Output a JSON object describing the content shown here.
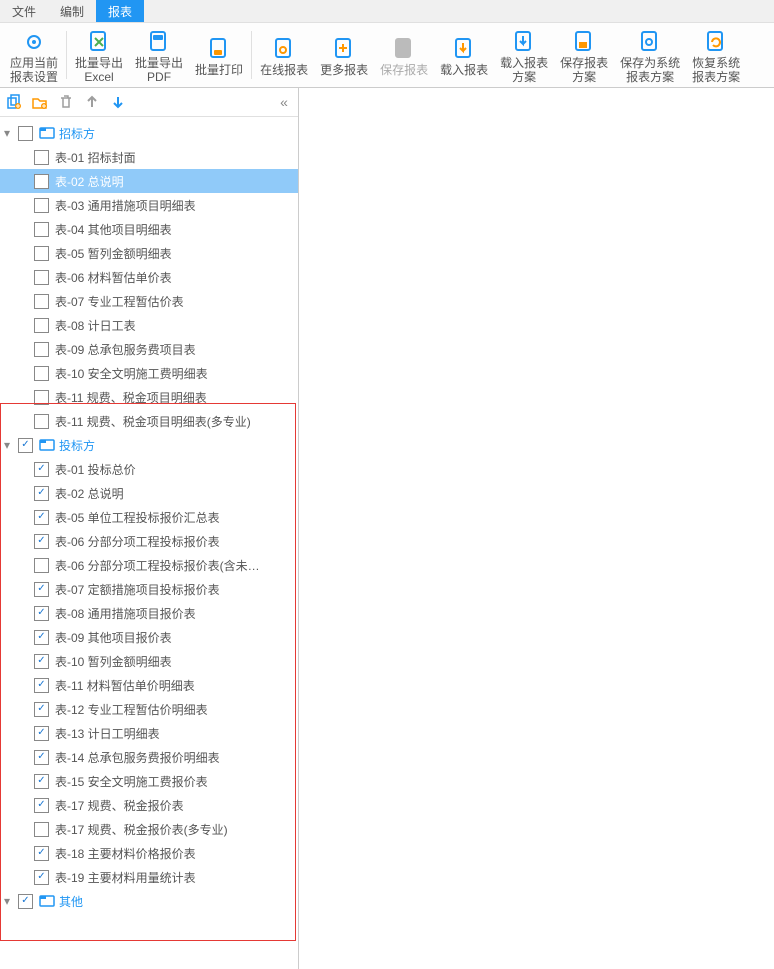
{
  "menu": {
    "items": [
      "文件",
      "编制",
      "报表"
    ],
    "active_index": 2
  },
  "ribbon": [
    {
      "id": "apply-current",
      "icon": "gear",
      "label": "应用当前\n报表设置",
      "disabled": false
    },
    {
      "sep": true
    },
    {
      "id": "batch-export-excel",
      "icon": "page-x",
      "label": "批量导出\nExcel",
      "disabled": false
    },
    {
      "id": "batch-export-pdf",
      "icon": "page-pdf",
      "label": "批量导出\nPDF",
      "disabled": false
    },
    {
      "id": "batch-print",
      "icon": "page-print",
      "label": "批量打印",
      "disabled": false
    },
    {
      "sep": true
    },
    {
      "id": "online-report",
      "icon": "page-cloud",
      "label": "在线报表",
      "disabled": false
    },
    {
      "id": "more-reports",
      "icon": "page-more",
      "label": "更多报表",
      "disabled": false
    },
    {
      "id": "save-report",
      "icon": "page-save",
      "label": "保存报表",
      "disabled": true
    },
    {
      "id": "import-report",
      "icon": "page-import",
      "label": "载入报表",
      "disabled": false
    },
    {
      "id": "import-report-scheme",
      "icon": "page-import2",
      "label": "载入报表\n方案",
      "disabled": false
    },
    {
      "id": "save-report-scheme",
      "icon": "page-save2",
      "label": "保存报表\n方案",
      "disabled": false
    },
    {
      "id": "save-as-system",
      "icon": "page-sys",
      "label": "保存为系统\n报表方案",
      "disabled": false
    },
    {
      "id": "restore-system",
      "icon": "page-restore",
      "label": "恢复系统\n报表方案",
      "disabled": false
    }
  ],
  "side_tb": {
    "icons": [
      {
        "id": "copy-add",
        "name": "copy-add-icon"
      },
      {
        "id": "folder-add",
        "name": "folder-add-icon"
      },
      {
        "id": "delete",
        "name": "trash-icon"
      },
      {
        "id": "move-up",
        "name": "arrow-up-icon"
      },
      {
        "id": "move-down",
        "name": "arrow-down-icon"
      }
    ],
    "collapse": "«"
  },
  "tree": [
    {
      "kind": "group",
      "label": "招标方",
      "checked": false,
      "blue": true,
      "children": [
        {
          "label": "表-01 招标封面",
          "checked": false
        },
        {
          "label": "表-02 总说明",
          "checked": false,
          "selected": true
        },
        {
          "label": "表-03 通用措施项目明细表",
          "checked": false
        },
        {
          "label": "表-04 其他项目明细表",
          "checked": false
        },
        {
          "label": "表-05 暂列金额明细表",
          "checked": false
        },
        {
          "label": "表-06 材料暂估单价表",
          "checked": false
        },
        {
          "label": "表-07 专业工程暂估价表",
          "checked": false
        },
        {
          "label": "表-08 计日工表",
          "checked": false
        },
        {
          "label": "表-09 总承包服务费项目表",
          "checked": false
        },
        {
          "label": "表-10 安全文明施工费明细表",
          "checked": false
        },
        {
          "label": "表-11 规费、税金项目明细表",
          "checked": false
        },
        {
          "label": "表-11 规费、税金项目明细表(多专业)",
          "checked": false
        }
      ]
    },
    {
      "kind": "group",
      "label": "投标方",
      "checked": true,
      "blue": true,
      "children": [
        {
          "label": "表-01 投标总价",
          "checked": true
        },
        {
          "label": "表-02 总说明",
          "checked": true
        },
        {
          "label": "表-05 单位工程投标报价汇总表",
          "checked": true
        },
        {
          "label": "表-06 分部分项工程投标报价表",
          "checked": true
        },
        {
          "label": "表-06 分部分项工程投标报价表(含未…",
          "checked": false
        },
        {
          "label": "表-07 定额措施项目投标报价表",
          "checked": true
        },
        {
          "label": "表-08 通用措施项目报价表",
          "checked": true
        },
        {
          "label": "表-09 其他项目报价表",
          "checked": true
        },
        {
          "label": "表-10 暂列金额明细表",
          "checked": true
        },
        {
          "label": "表-11 材料暂估单价明细表",
          "checked": true
        },
        {
          "label": "表-12 专业工程暂估价明细表",
          "checked": true
        },
        {
          "label": "表-13 计日工明细表",
          "checked": true
        },
        {
          "label": "表-14 总承包服务费报价明细表",
          "checked": true
        },
        {
          "label": "表-15 安全文明施工费报价表",
          "checked": true
        },
        {
          "label": "表-17 规费、税金报价表",
          "checked": true
        },
        {
          "label": "表-17 规费、税金报价表(多专业)",
          "checked": false
        },
        {
          "label": "表-18 主要材料价格报价表",
          "checked": true
        },
        {
          "label": "表-19 主要材料用量统计表",
          "checked": true
        }
      ]
    },
    {
      "kind": "group",
      "label": "其他",
      "checked": true,
      "blue": true,
      "children": []
    }
  ]
}
